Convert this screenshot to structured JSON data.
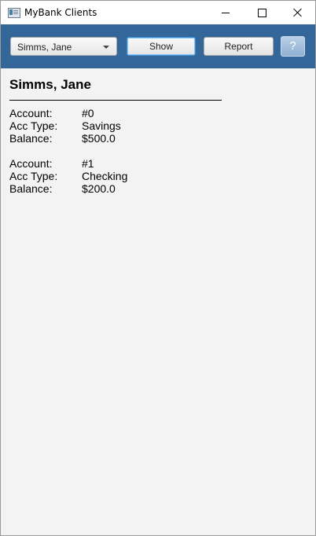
{
  "window": {
    "title": "MyBank Clients"
  },
  "toolbar": {
    "client_select_value": "Simms, Jane",
    "show_label": "Show",
    "report_label": "Report",
    "help_label": "?"
  },
  "client": {
    "name": "Simms, Jane",
    "accounts": [
      {
        "account_label": "Account:",
        "account_value": "#0",
        "type_label": "Acc Type:",
        "type_value": "Savings",
        "balance_label": "Balance:",
        "balance_value": "$500.0"
      },
      {
        "account_label": "Account:",
        "account_value": "#1",
        "type_label": "Acc Type:",
        "type_value": "Checking",
        "balance_label": "Balance:",
        "balance_value": "$200.0"
      }
    ]
  },
  "colors": {
    "toolbar_bg": "#336699",
    "content_bg": "#f3f3f3"
  }
}
